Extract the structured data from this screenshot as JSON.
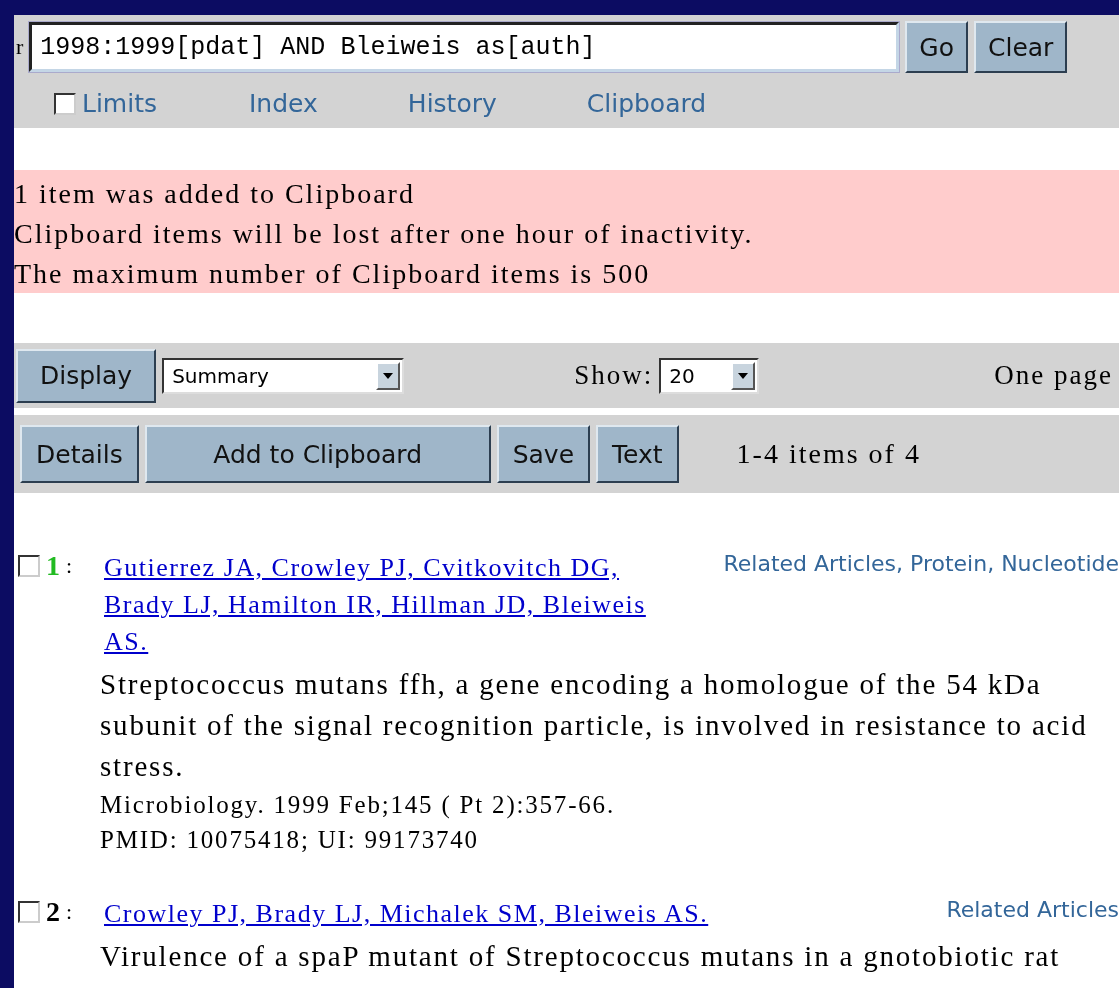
{
  "search": {
    "label_fragment": "r",
    "query": "1998:1999[pdat] AND Bleiweis as[auth]",
    "buttons": [
      "Go",
      "Clear"
    ]
  },
  "nav_links": [
    {
      "kind": "checkbox",
      "label": "Limits",
      "checked": false
    },
    {
      "kind": "link",
      "label": "Index"
    },
    {
      "kind": "link",
      "label": "History"
    },
    {
      "kind": "link",
      "label": "Clipboard"
    }
  ],
  "notice": {
    "lines": [
      "1 item was added to Clipboard",
      "Clipboard items will be lost after one hour of inactivity.",
      "The maximum number of Clipboard items is 500"
    ]
  },
  "display_bar": {
    "button": "Display",
    "format": "Summary",
    "show_label": "Show:",
    "show_value": "20",
    "pages": "One page"
  },
  "action_bar": {
    "buttons": [
      "Details",
      "Add to Clipboard",
      "Save",
      "Text"
    ],
    "count": "1-4 items of 4"
  },
  "results": [
    {
      "checked": false,
      "number": "1",
      "separator": ":",
      "current": true,
      "authors": "Gutierrez JA, Crowley PJ, Cvitkovitch DG, Brady LJ, Hamilton IR, Hillman JD, Bleiweis AS.",
      "links": [
        "Related Articles,",
        "Protein,",
        "Nucleotide"
      ],
      "title": "Streptococcus mutans ffh, a gene encoding a homologue of the 54 kDa subunit of the signal recognition particle, is involved in resistance to acid stress.",
      "citation": "Microbiology. 1999 Feb;145 ( Pt 2):357-66.",
      "ids": "PMID: 10075418; UI: 99173740"
    },
    {
      "checked": false,
      "number": "2",
      "separator": ":",
      "current": false,
      "authors": "Crowley PJ, Brady LJ, Michalek SM, Bleiweis AS.",
      "links": [
        "Related Articles"
      ],
      "title": "Virulence of a spaP mutant of Streptococcus mutans in a gnotobiotic rat"
    }
  ]
}
